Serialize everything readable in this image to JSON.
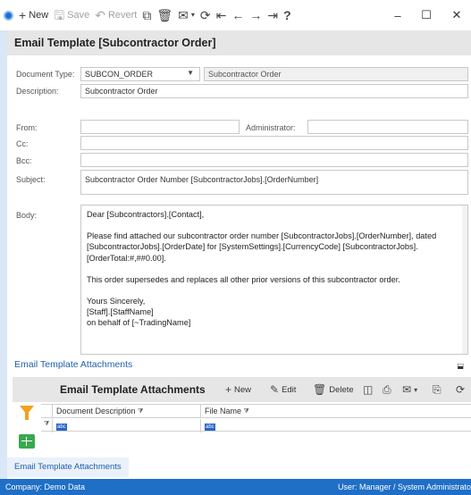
{
  "toolbar": {
    "new_label": "New",
    "save_label": "Save",
    "revert_label": "Revert"
  },
  "header": {
    "title": "Email Template [Subcontractor Order]"
  },
  "form": {
    "document_type_label": "Document Type:",
    "document_type_value": "SUBCON_ORDER",
    "document_type_description": "Subcontractor Order",
    "description_label": "Description:",
    "description_value": "Subcontractor Order",
    "from_label": "From:",
    "from_value": "",
    "administrator_label": "Administrator:",
    "administrator_value": "",
    "cc_label": "Cc:",
    "cc_value": "",
    "bcc_label": "Bcc:",
    "bcc_value": "",
    "subject_label": "Subject:",
    "subject_value": "Subcontractor Order Number [SubcontractorJobs].[OrderNumber]",
    "body_label": "Body:",
    "body_paragraphs": [
      "Dear [Subcontractors].[Contact],",
      "Please find attached our subcontractor order number [SubcontractorJobs].[OrderNumber], dated [SubcontractorJobs].[OrderDate] for [SystemSettings].[CurrencyCode] [SubcontractorJobs].[OrderTotal:#,##0.00].",
      "This order supersedes and replaces all other prior versions of this subcontractor order.",
      "Yours Sincerely,\n[Staff].[StaffName]\non behalf of [~TradingName]"
    ]
  },
  "attachments": {
    "section_title": "Email Template Attachments",
    "grid_title": "Email Template Attachments",
    "buttons": {
      "new": "New",
      "edit": "Edit",
      "delete": "Delete"
    },
    "columns": [
      "Document Description",
      "File Name"
    ],
    "filter_placeholder": "abc"
  },
  "bottom_tab": {
    "label": "Email Template Attachments"
  },
  "status": {
    "company": "Company: Demo Data",
    "user": "User: Manager / System Administrato"
  },
  "colors": {
    "accent": "#1f6fc6",
    "header_band": "#e6e6e6",
    "filter_icon": "#f2a21a",
    "grid_icon": "#3aa84f"
  }
}
